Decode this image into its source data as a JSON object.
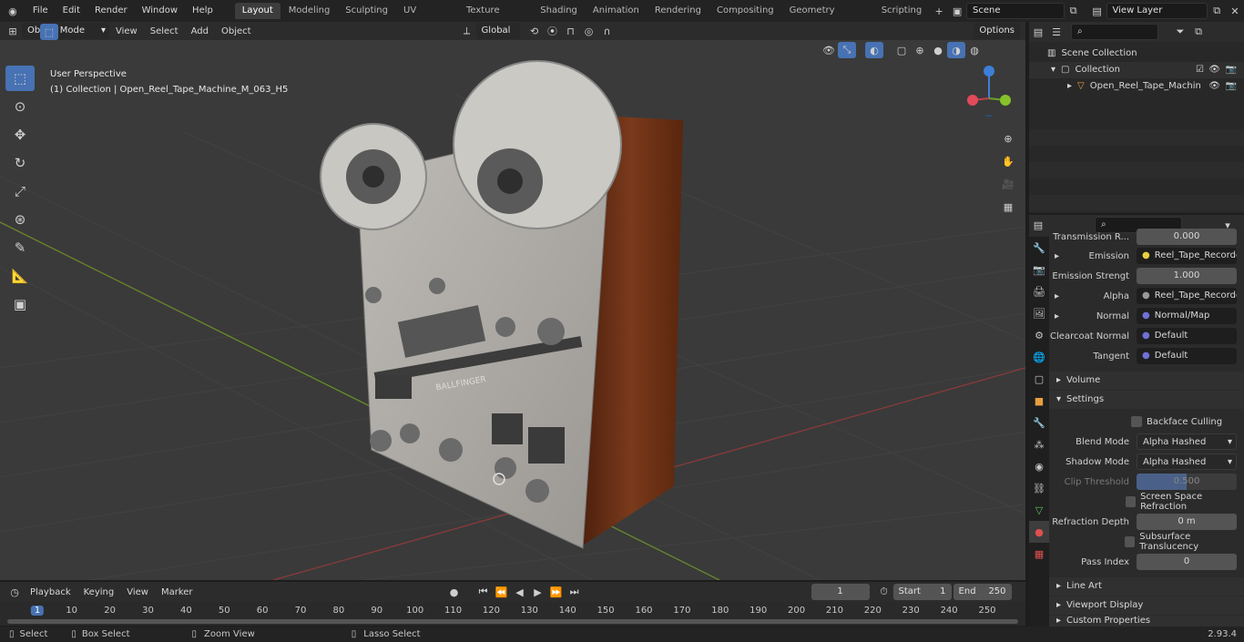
{
  "topbar": {
    "menus": [
      "File",
      "Edit",
      "Render",
      "Window",
      "Help"
    ],
    "workspaces": [
      "Layout",
      "Modeling",
      "Sculpting",
      "UV Editing",
      "Texture Paint",
      "Shading",
      "Animation",
      "Rendering",
      "Compositing",
      "Geometry Nodes",
      "Scripting"
    ],
    "active_workspace": "Layout",
    "scene": "Scene",
    "view_layer": "View Layer"
  },
  "viewport": {
    "mode": "Object Mode",
    "menus": [
      "View",
      "Select",
      "Add",
      "Object"
    ],
    "transform": "Global",
    "options": "Options",
    "overlay_title": "User Perspective",
    "overlay_subtitle": "(1) Collection | Open_Reel_Tape_Machine_M_063_H5",
    "model_brand": "BALLFINGER"
  },
  "outliner": {
    "rows": [
      "Scene Collection",
      "Collection",
      "Open_Reel_Tape_Machin"
    ]
  },
  "properties": {
    "rows": [
      {
        "label": "Transmission R...",
        "value": "0.000",
        "kind": "num"
      },
      {
        "label": "Emission",
        "value": "Reel_Tape_Recorder...",
        "kind": "link"
      },
      {
        "label": "Emission Strengt",
        "value": "1.000",
        "kind": "num"
      },
      {
        "label": "Alpha",
        "value": "Reel_Tape_Recorder...",
        "kind": "link"
      },
      {
        "label": "Normal",
        "value": "Normal/Map",
        "kind": "link"
      },
      {
        "label": "Clearcoat Normal",
        "value": "Default",
        "kind": "link"
      },
      {
        "label": "Tangent",
        "value": "Default",
        "kind": "link"
      }
    ],
    "volume": "Volume",
    "settings": "Settings",
    "backface_culling": "Backface Culling",
    "blend_mode_label": "Blend Mode",
    "blend_mode": "Alpha Hashed",
    "shadow_mode_label": "Shadow Mode",
    "shadow_mode": "Alpha Hashed",
    "clip_threshold_label": "Clip Threshold",
    "clip_threshold": "0.500",
    "ssr": "Screen Space Refraction",
    "refraction_depth_label": "Refraction Depth",
    "refraction_depth": "0 m",
    "subsurface": "Subsurface Translucency",
    "pass_index_label": "Pass Index",
    "pass_index": "0",
    "line_art": "Line Art",
    "viewport_display": "Viewport Display",
    "custom_properties": "Custom Properties"
  },
  "timeline": {
    "menus": [
      "Playback",
      "Keying",
      "View",
      "Marker"
    ],
    "current_frame": "1",
    "start_label": "Start",
    "start": "1",
    "end_label": "End",
    "end": "250",
    "ticks": [
      "1",
      "10",
      "20",
      "30",
      "40",
      "50",
      "60",
      "70",
      "80",
      "90",
      "100",
      "110",
      "120",
      "130",
      "140",
      "150",
      "160",
      "170",
      "180",
      "190",
      "200",
      "210",
      "220",
      "230",
      "240",
      "250"
    ]
  },
  "statusbar": {
    "select": "Select",
    "box_select": "Box Select",
    "zoom_view": "Zoom View",
    "lasso_select": "Lasso Select",
    "version": "2.93.4"
  },
  "colors": {
    "accent": "#4772b3",
    "wood": "#6a3018",
    "grid_x": "#8a3a3a",
    "grid_y": "#6a8a2a"
  }
}
